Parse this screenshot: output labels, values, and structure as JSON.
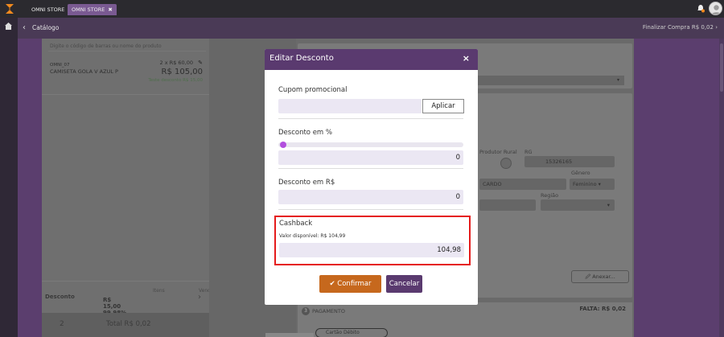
{
  "colors": {
    "brand": "#5a3a6f",
    "accent_orange": "#c6681d",
    "highlight_red": "#e51b1b",
    "slider_knob": "#b24fde"
  },
  "tabs": [
    {
      "label": "OMNI STORE"
    },
    {
      "label": "OMNI STORE",
      "close": "✖"
    }
  ],
  "header": {
    "title": "Catálogo",
    "finalize": "Finalizar Compra  R$ 0,02"
  },
  "cart": {
    "search_placeholder": "Digite o código de barras ou nome do produto",
    "item": {
      "code": "OMNI_07",
      "name": "CAMISETA GOLA V AZUL P",
      "qty_price": "2 x R$ 60,00",
      "total": "R$ 105,00",
      "discount_note": "Teste desconto R$ 15,00"
    },
    "summary": {
      "label": "Desconto",
      "col1_head": "Itens",
      "col2_head": "Venda",
      "values": "R$ 15,00  99,98% | R$ 104,98"
    },
    "footer": {
      "count": "2",
      "total": "Total R$ 0,02"
    }
  },
  "form": {
    "produtor_rural": "Produtor Rural",
    "rg_label": "RG",
    "rg_value": "15326165",
    "genero_label": "Gênero",
    "genero_value": "Feminino",
    "name_fragment": "CARDO",
    "regiao_label": "Região",
    "anexar": "Anexar...",
    "payment_num": "3",
    "payment_label": "PAGAMENTO",
    "falta": "FALTA: R$ 0,02",
    "payment_method": "Cartão Débito"
  },
  "modal": {
    "title": "Editar Desconto",
    "close": "×",
    "coupon_label": "Cupom promocional",
    "coupon_value": "",
    "apply_label": "Aplicar",
    "percent_label": "Desconto em %",
    "percent_value": "0",
    "amount_label": "Desconto em R$",
    "amount_value": "0",
    "cashback_label": "Cashback",
    "cashback_available": "Valor disponível: R$ 104,99",
    "cashback_value": "104,98",
    "confirm_label": "Confirmar",
    "cancel_label": "Cancelar"
  }
}
